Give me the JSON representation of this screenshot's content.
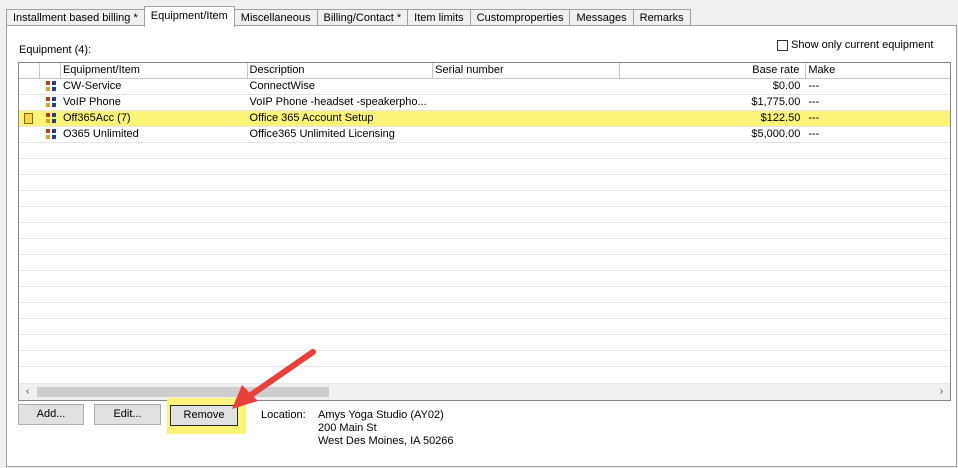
{
  "tabs": [
    {
      "label": "Installment based billing *",
      "active": false
    },
    {
      "label": "Equipment/Item",
      "active": true
    },
    {
      "label": "Miscellaneous",
      "active": false
    },
    {
      "label": "Billing/Contact *",
      "active": false
    },
    {
      "label": "Item limits",
      "active": false
    },
    {
      "label": "Customproperties",
      "active": false
    },
    {
      "label": "Messages",
      "active": false
    },
    {
      "label": "Remarks",
      "active": false
    }
  ],
  "equipment": {
    "label": "Equipment (4):",
    "show_only_current_label": "Show only current equipment",
    "show_only_current_checked": false,
    "columns": [
      "",
      "",
      "Equipment/Item",
      "Description",
      "Serial number",
      "Base rate",
      "Make"
    ],
    "rows": [
      {
        "flag": false,
        "item": "CW-Service",
        "description": "ConnectWise",
        "serial": "",
        "base_rate": "$0.00",
        "make": "---",
        "highlighted": false
      },
      {
        "flag": false,
        "item": "VoIP Phone",
        "description": "VoIP Phone -headset -speakerpho...",
        "serial": "",
        "base_rate": "$1,775.00",
        "make": "---",
        "highlighted": false
      },
      {
        "flag": true,
        "item": "Off365Acc (7)",
        "description": "Office 365 Account Setup",
        "serial": "",
        "base_rate": "$122.50",
        "make": "---",
        "highlighted": true
      },
      {
        "flag": false,
        "item": "O365 Unlimited",
        "description": "Office365 Unlimited Licensing",
        "serial": "",
        "base_rate": "$5,000.00",
        "make": "---",
        "highlighted": false
      }
    ]
  },
  "buttons": {
    "add": "Add...",
    "edit": "Edit...",
    "remove": "Remove"
  },
  "location": {
    "label": "Location:",
    "name": "Amys Yoga Studio (AY02)",
    "street": "200 Main St",
    "city": "West Des Moines, IA 50266"
  },
  "colors": {
    "highlight": "#fbf478",
    "arrow": "#e8403a"
  }
}
